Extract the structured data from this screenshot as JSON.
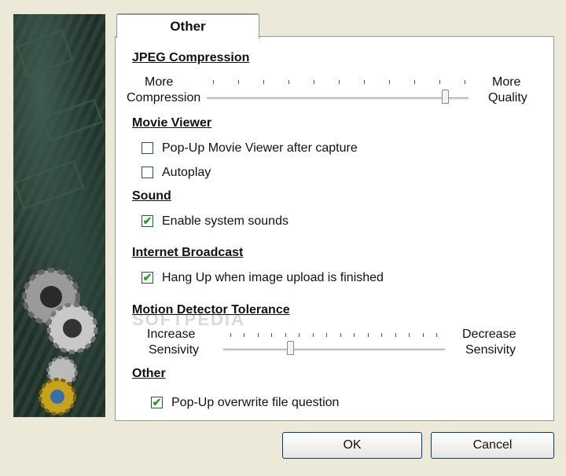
{
  "tab": {
    "label": "Other"
  },
  "sections": {
    "jpeg": {
      "title": "JPEG Compression",
      "left_label_1": "More",
      "left_label_2": "Compression",
      "right_label_1": "More",
      "right_label_2": "Quality",
      "slider_fraction": 0.91
    },
    "movie": {
      "title": "Movie Viewer",
      "popup_label": "Pop-Up Movie Viewer after capture",
      "popup_checked": false,
      "autoplay_label": "Autoplay",
      "autoplay_checked": false
    },
    "sound": {
      "title": "Sound",
      "enable_label": "Enable system sounds",
      "enable_checked": true
    },
    "internet": {
      "title": "Internet Broadcast",
      "hangup_label": "Hang Up when image upload is finished",
      "hangup_checked": true
    },
    "motion": {
      "title": "Motion Detector Tolerance",
      "left_label_1": "Increase",
      "left_label_2": "Sensivity",
      "right_label_1": "Decrease",
      "right_label_2": "Sensivity",
      "slider_fraction": 0.3
    },
    "other": {
      "title": "Other",
      "overwrite_label": "Pop-Up overwrite file question",
      "overwrite_checked": true
    }
  },
  "buttons": {
    "ok": "OK",
    "cancel": "Cancel"
  },
  "watermark": "SOFTPEDIA"
}
